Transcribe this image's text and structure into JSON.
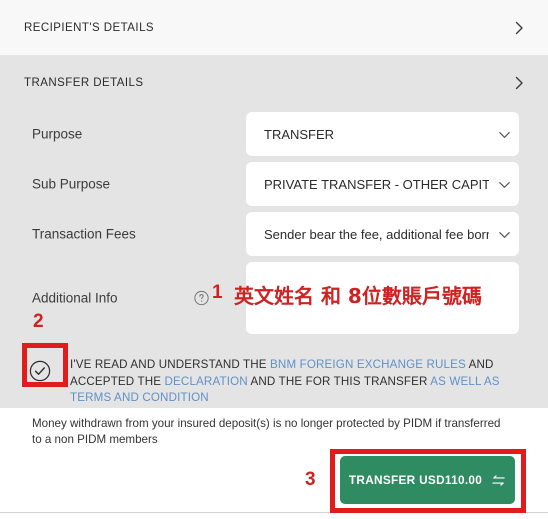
{
  "sections": {
    "recipient": {
      "title": "RECIPIENT'S DETAILS",
      "chevron_icon": "chevron-right-icon"
    },
    "transfer": {
      "title": "TRANSFER DETAILS",
      "chevron_icon": "chevron-right-icon"
    }
  },
  "form": {
    "purpose": {
      "label": "Purpose",
      "value": "TRANSFER"
    },
    "sub_purpose": {
      "label": "Sub Purpose",
      "value": "PRIVATE TRANSFER - OTHER CAPITAL"
    },
    "transaction_fees": {
      "label": "Transaction Fees",
      "value": "Sender bear the fee, additional fee borne by sender"
    },
    "additional_info": {
      "label": "Additional Info",
      "help_icon": "question-mark-circle-icon",
      "value": "",
      "placeholder": ""
    }
  },
  "terms": {
    "checked": true,
    "checkbox_icon": "check-circle-icon",
    "part1": "I'VE READ AND UNDERSTAND THE ",
    "link1": "BNM FOREIGN EXCHANGE RULES",
    "part2": " AND ACCEPTED THE ",
    "link2": "DECLARATION",
    "part3": " AND THE FOR THIS TRANSFER ",
    "link3": "AS WELL AS TERMS AND CONDITION",
    "link_color": "#6091c6"
  },
  "footer": {
    "pidm_note": "Money withdrawn from your insured deposit(s) is no longer protected by PIDM if transferred to a non PIDM members"
  },
  "transfer_button": {
    "label": "TRANSFER USD110.00",
    "icon": "exchange-arrows-icon",
    "color": "#2e8b62"
  },
  "annotations": {
    "num1": "1",
    "num2": "2",
    "num3": "3",
    "cjk_note": "英文姓名 和 8位數賬戶號碼",
    "color": "#cf2222",
    "box_color": "#e01c1c"
  }
}
